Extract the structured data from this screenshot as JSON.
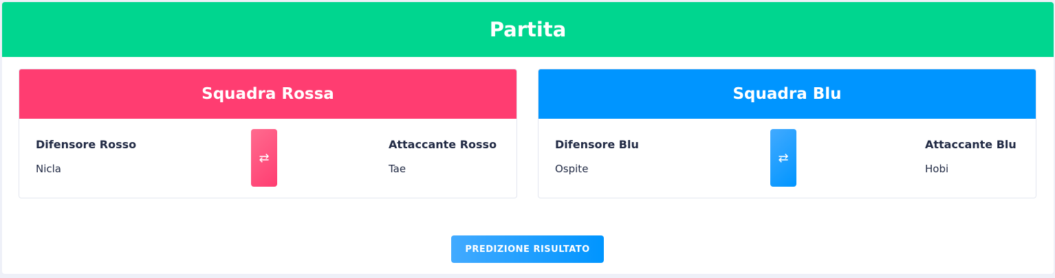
{
  "match": {
    "title": "Partita"
  },
  "teams": {
    "red": {
      "name": "Squadra Rossa",
      "color": "#ff3d71",
      "defender_label": "Difensore Rosso",
      "defender_value": "Nicla",
      "attacker_label": "Attaccante Rosso",
      "attacker_value": "Tae",
      "swap_icon": "swap-arrows-icon"
    },
    "blue": {
      "name": "Squadra Blu",
      "color": "#0095ff",
      "defender_label": "Difensore Blu",
      "defender_value": "Ospite",
      "attacker_label": "Attaccante Blu",
      "attacker_value": "Hobi",
      "swap_icon": "swap-arrows-icon"
    }
  },
  "actions": {
    "predict_label": "PREDIZIONE RISULTATO"
  },
  "colors": {
    "header": "#00d68f",
    "primary": "#0095ff",
    "danger": "#ff3d71"
  }
}
